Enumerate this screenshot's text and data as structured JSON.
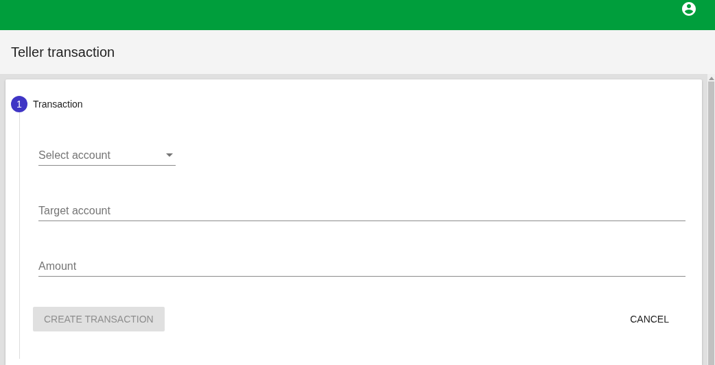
{
  "page": {
    "title": "Teller transaction"
  },
  "stepper": {
    "steps": [
      {
        "number": "1",
        "label": "Transaction",
        "selected": true
      }
    ]
  },
  "fields": [
    {
      "kind": "select",
      "placeholder": "Select account"
    },
    {
      "kind": "input",
      "placeholder": "Target account"
    },
    {
      "kind": "input",
      "placeholder": "Amount"
    }
  ],
  "buttons": [
    {
      "label": "CREATE TRANSACTION",
      "kind": "raised",
      "disabled": true
    },
    {
      "label": "CANCEL",
      "kind": "flat",
      "disabled": false
    }
  ]
}
